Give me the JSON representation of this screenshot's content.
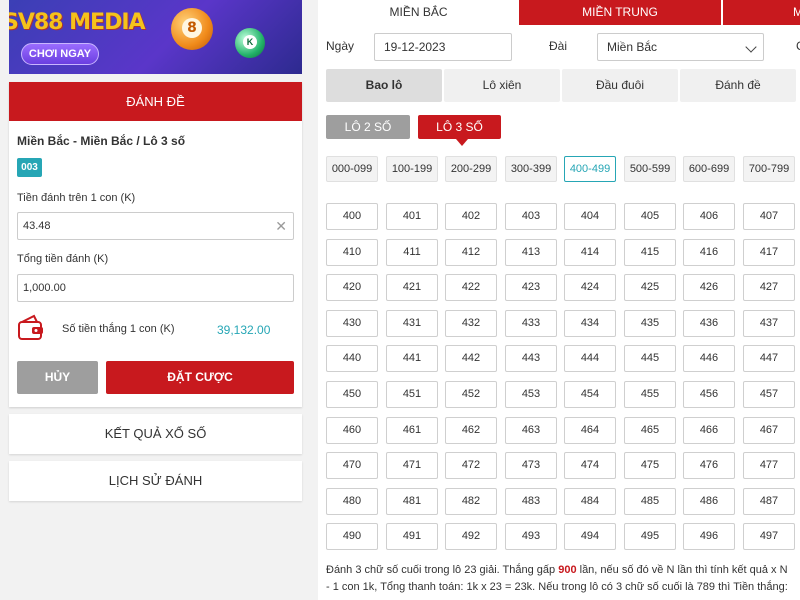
{
  "banner": {
    "title": "SV88 MEDIA",
    "cta": "CHƠI NGAY",
    "ball_orange": "8",
    "ball_green": "K"
  },
  "bet": {
    "header": "ĐÁNH ĐỀ",
    "path": "Miền Bắc - Miền Bắc / Lô 3 số",
    "selected_number": "003",
    "stake_label": "Tiền đánh trên 1 con (K)",
    "stake_value": "43.48",
    "total_label": "Tổng tiền đánh (K)",
    "total_value": "1,000.00",
    "win_label": "Số tiền thắng 1 con (K)",
    "win_value": "39,132.00",
    "cancel": "HỦY",
    "place": "ĐẶT CƯỢC"
  },
  "side_links": {
    "results": "KẾT QUẢ XỔ SỐ",
    "history": "LỊCH SỬ ĐÁNH"
  },
  "regions": [
    "MIỀN BẮC",
    "MIỀN TRUNG",
    "M"
  ],
  "filters": {
    "date_label": "Ngày",
    "date_value": "19-12-2023",
    "station_label": "Đài",
    "station_value": "Miền Bắc",
    "extra": "C"
  },
  "bet_types": [
    "Bao lô",
    "Lô xiên",
    "Đầu đuôi",
    "Đánh đề"
  ],
  "sub_types": [
    "LÔ 2 SỐ",
    "LÔ 3 SỐ"
  ],
  "ranges": [
    "000-099",
    "100-199",
    "200-299",
    "300-399",
    "400-499",
    "500-599",
    "600-699",
    "700-799"
  ],
  "active_range": "400-499",
  "numbers": [
    [
      "400",
      "401",
      "402",
      "403",
      "404",
      "405",
      "406",
      "407"
    ],
    [
      "410",
      "411",
      "412",
      "413",
      "414",
      "415",
      "416",
      "417"
    ],
    [
      "420",
      "421",
      "422",
      "423",
      "424",
      "425",
      "426",
      "427"
    ],
    [
      "430",
      "431",
      "432",
      "433",
      "434",
      "435",
      "436",
      "437"
    ],
    [
      "440",
      "441",
      "442",
      "443",
      "444",
      "445",
      "446",
      "447"
    ],
    [
      "450",
      "451",
      "452",
      "453",
      "454",
      "455",
      "456",
      "457"
    ],
    [
      "460",
      "461",
      "462",
      "463",
      "464",
      "465",
      "466",
      "467"
    ],
    [
      "470",
      "471",
      "472",
      "473",
      "474",
      "475",
      "476",
      "477"
    ],
    [
      "480",
      "481",
      "482",
      "483",
      "484",
      "485",
      "486",
      "487"
    ],
    [
      "490",
      "491",
      "492",
      "493",
      "494",
      "495",
      "496",
      "497"
    ]
  ],
  "description": {
    "part1": "Đánh 3 chữ số cuối trong lô 23 giải. Thắng gấp ",
    "highlight": "900",
    "part2": " lần, nếu số đó về N lần thì tính kết quả x N",
    "line2": "- 1 con 1k, Tổng thanh toán: 1k x 23 = 23k. Nếu trong lô có 3 chữ số cuối là 789 thì Tiền thắng:"
  },
  "colors": {
    "brand_red": "#c8191e",
    "accent_teal": "#26a6b5",
    "grey_button": "#9e9e9e"
  }
}
